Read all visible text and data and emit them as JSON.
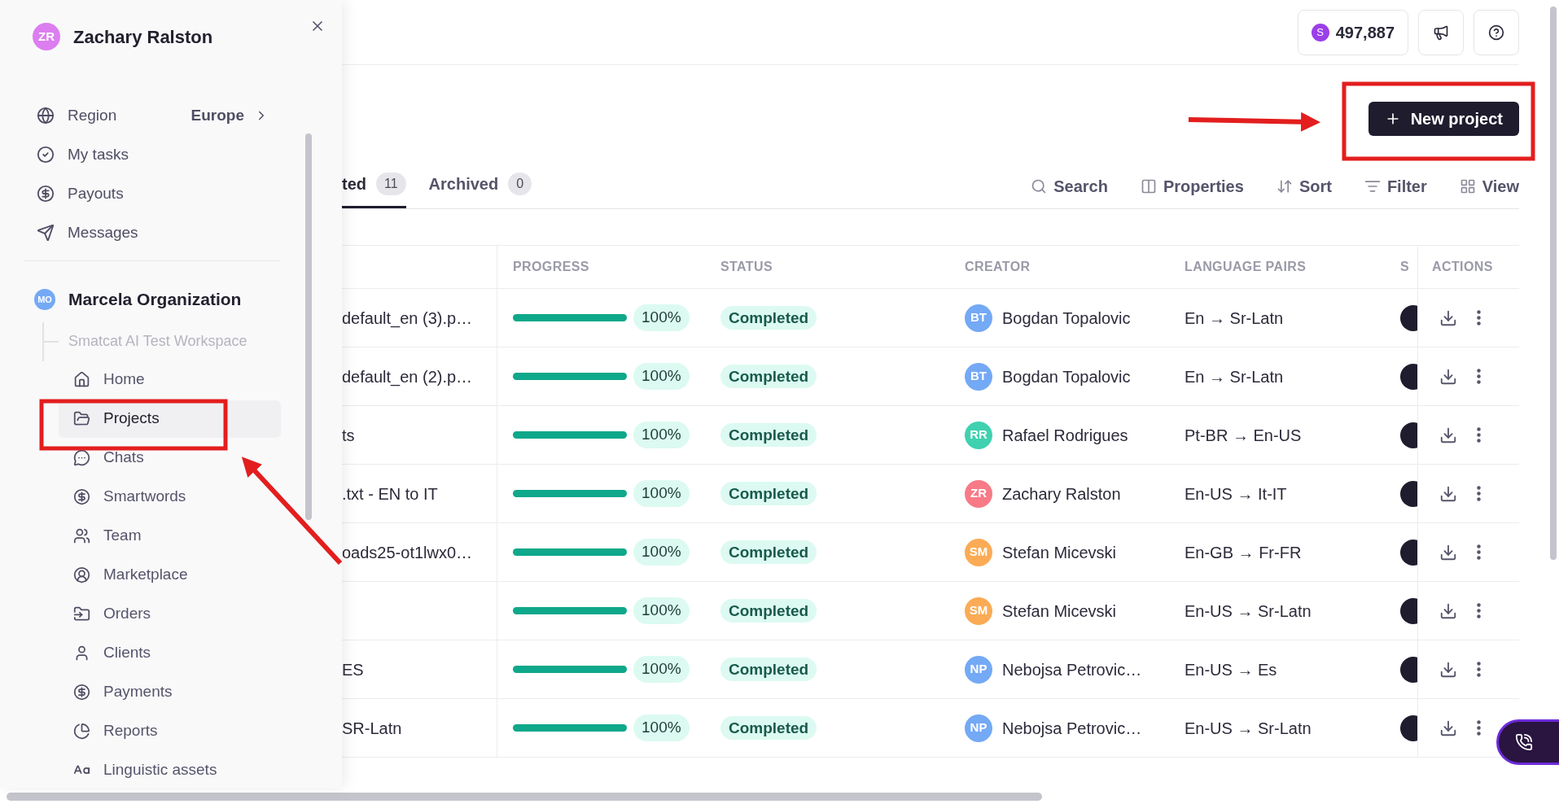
{
  "sidebar": {
    "user": {
      "initials": "ZR",
      "name": "Zachary Ralston"
    },
    "menu": [
      {
        "label": "Region",
        "value": "Europe"
      },
      {
        "label": "My tasks"
      },
      {
        "label": "Payouts"
      },
      {
        "label": "Messages"
      }
    ],
    "organization": {
      "initials": "MO",
      "name": "Marcela Organization"
    },
    "workspace": "Smatcat AI Test Workspace",
    "nav": [
      {
        "label": "Home",
        "selected": false
      },
      {
        "label": "Projects",
        "selected": true
      },
      {
        "label": "Chats",
        "selected": false
      },
      {
        "label": "Smartwords",
        "selected": false
      },
      {
        "label": "Team",
        "selected": false
      },
      {
        "label": "Marketplace",
        "selected": false
      },
      {
        "label": "Orders",
        "selected": false
      },
      {
        "label": "Clients",
        "selected": false
      },
      {
        "label": "Payments",
        "selected": false
      },
      {
        "label": "Reports",
        "selected": false
      },
      {
        "label": "Linguistic assets",
        "selected": false
      }
    ]
  },
  "top_bar": {
    "balance_letter": "S",
    "balance": "497,887"
  },
  "new_project": "New project",
  "tabs": [
    {
      "label": "ted",
      "count": "11",
      "selected": true
    },
    {
      "label": "Archived",
      "count": "0",
      "selected": false
    }
  ],
  "toolbar": [
    "Search",
    "Properties",
    "Sort",
    "Filter",
    "View"
  ],
  "table": {
    "columns": [
      "PROGRESS",
      "STATUS",
      "CREATOR",
      "LANGUAGE PAIRS",
      "S",
      "ACTIONS"
    ],
    "rows": [
      {
        "name": "default_en (3).p…",
        "level": 1,
        "progress": "100%",
        "status": "Completed",
        "initials": "BT",
        "color": "#74a9f5",
        "creator": "Bogdan Topalovic",
        "language_pair": "En → Sr-Latn"
      },
      {
        "name": "default_en (2).p…",
        "level": 1,
        "progress": "100%",
        "status": "Completed",
        "initials": "BT",
        "color": "#74a9f5",
        "creator": "Bogdan Topalovic",
        "language_pair": "En → Sr-Latn"
      },
      {
        "name": "ts",
        "level": 1,
        "progress": "100%",
        "status": "Completed",
        "initials": "RR",
        "color": "#3fd1b0",
        "creator": "Rafael Rodrigues",
        "language_pair": "Pt-BR → En-US"
      },
      {
        "name": ".txt - EN to IT",
        "level": 1,
        "progress": "100%",
        "status": "Completed",
        "initials": "ZR",
        "color": "#f87a86",
        "creator": "Zachary Ralston",
        "language_pair": "En-US → It-IT"
      },
      {
        "name": "oads25-ot1lwx0…",
        "level": 1,
        "progress": "100%",
        "status": "Completed",
        "initials": "SM",
        "color": "#fbab55",
        "creator": "Stefan Micevski",
        "language_pair": "En-GB → Fr-FR"
      },
      {
        "level": 1,
        "progress": "100%",
        "status": "Completed",
        "initials": "SM",
        "color": "#fbab55",
        "creator": "Stefan Micevski",
        "language_pair": "En-US → Sr-Latn"
      },
      {
        "name": "ES",
        "level": 1,
        "progress": "100%",
        "status": "Completed",
        "initials": "NP",
        "color": "#74a9f5",
        "creator": "Nebojsa Petrovic…",
        "language_pair": "En-US → Es"
      },
      {
        "name": "SR-Latn",
        "level": 1,
        "progress": "100%",
        "status": "Completed",
        "initials": "NP",
        "color": "#74a9f5",
        "creator": "Nebojsa Petrovic…",
        "language_pair": "En-US → Sr-Latn"
      }
    ]
  }
}
